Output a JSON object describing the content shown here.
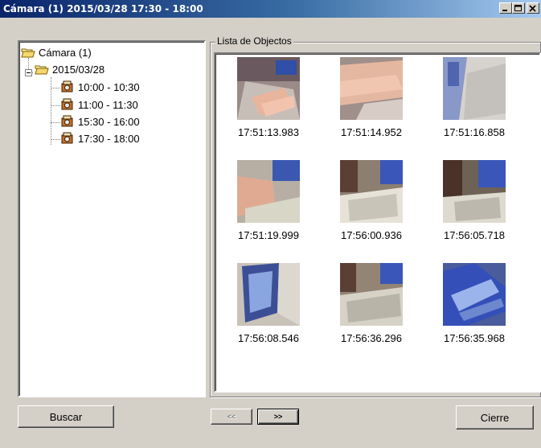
{
  "window": {
    "title": "Cámara (1)  2015/03/28 17:30 - 18:00"
  },
  "tree": {
    "root": "Cámara (1)",
    "date": "2015/03/28",
    "ranges": [
      "10:00 - 10:30",
      "11:00 - 11:30",
      "15:30 - 16:00",
      "17:30 - 18:00"
    ]
  },
  "objects": {
    "group_label": "Lista de Objectos",
    "items": [
      {
        "time": "17:51:13.983",
        "scene": "hand-keyboard"
      },
      {
        "time": "17:51:14.952",
        "scene": "hand-closeup"
      },
      {
        "time": "17:51:16.858",
        "scene": "monitor-grey"
      },
      {
        "time": "17:51:19.999",
        "scene": "hand-keyboard-blue"
      },
      {
        "time": "17:56:00.936",
        "scene": "desk-keyboard"
      },
      {
        "time": "17:56:05.718",
        "scene": "desk-keyboard-dark"
      },
      {
        "time": "17:56:08.546",
        "scene": "monitor-screen"
      },
      {
        "time": "17:56:36.296",
        "scene": "desk-wide"
      },
      {
        "time": "17:56:35.968",
        "scene": "screen-blue"
      }
    ]
  },
  "buttons": {
    "search": "Buscar",
    "prev": "<<",
    "next": ">>",
    "close": "Cierre"
  }
}
